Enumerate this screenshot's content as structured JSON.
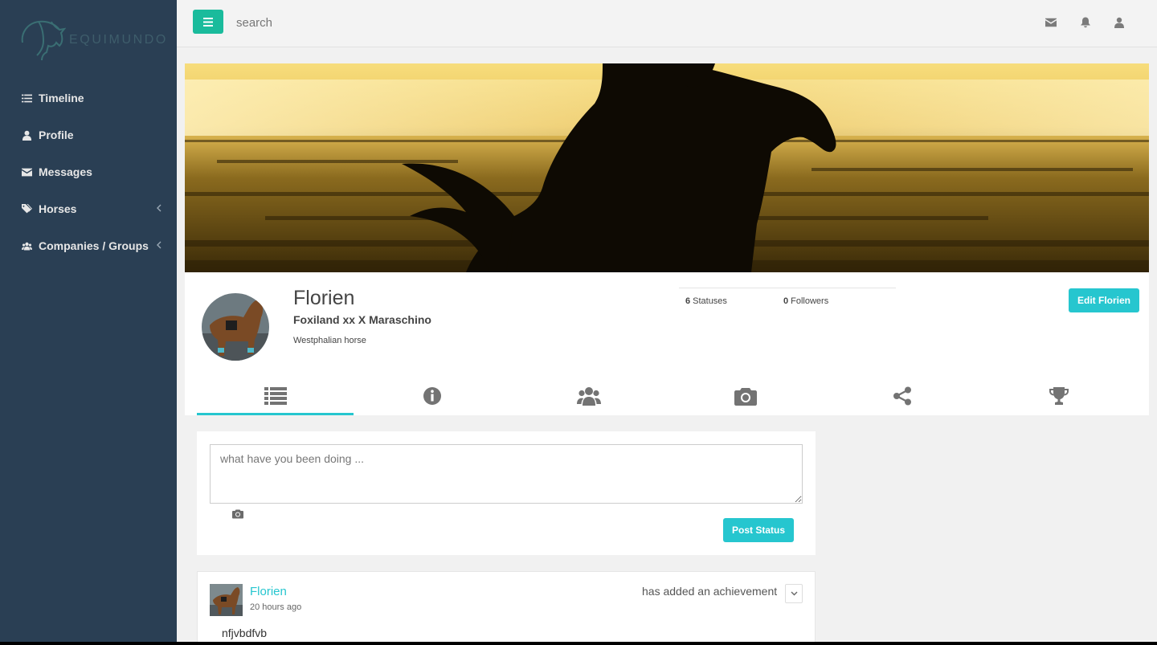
{
  "brand": {
    "name": "EQUIMUNDO",
    "logo_icon": "horse-head-logo"
  },
  "sidebar": {
    "items": [
      {
        "label": "Timeline",
        "icon": "list-icon",
        "has_submenu": false
      },
      {
        "label": "Profile",
        "icon": "user-icon",
        "has_submenu": false
      },
      {
        "label": "Messages",
        "icon": "envelope-icon",
        "has_submenu": false
      },
      {
        "label": "Horses",
        "icon": "tags-icon",
        "has_submenu": true
      },
      {
        "label": "Companies / Groups",
        "icon": "users-icon",
        "has_submenu": true
      }
    ]
  },
  "topbar": {
    "search_placeholder": "search",
    "icons": [
      "envelope-icon",
      "bell-icon",
      "user-icon"
    ]
  },
  "profile": {
    "name": "Florien",
    "breed": "Foxiland xx X Maraschino",
    "type": "Westphalian horse",
    "stats": {
      "statuses_count": "6",
      "statuses_label": "Statuses",
      "followers_count": "0",
      "followers_label": "Followers"
    },
    "edit_label": "Edit Florien",
    "tabs": [
      "list-icon",
      "info-icon",
      "users-icon",
      "camera-icon",
      "share-icon",
      "trophy-icon"
    ],
    "active_tab": 0
  },
  "composer": {
    "placeholder": "what have you been doing ...",
    "post_label": "Post Status"
  },
  "post": {
    "author": "Florien",
    "time": "20 hours ago",
    "action": "has added an achievement",
    "body": "nfjvbdfvb"
  },
  "colors": {
    "sidebar_bg": "#2a3f54",
    "accent": "#26c6cf",
    "menu_button": "#1abb9c"
  }
}
